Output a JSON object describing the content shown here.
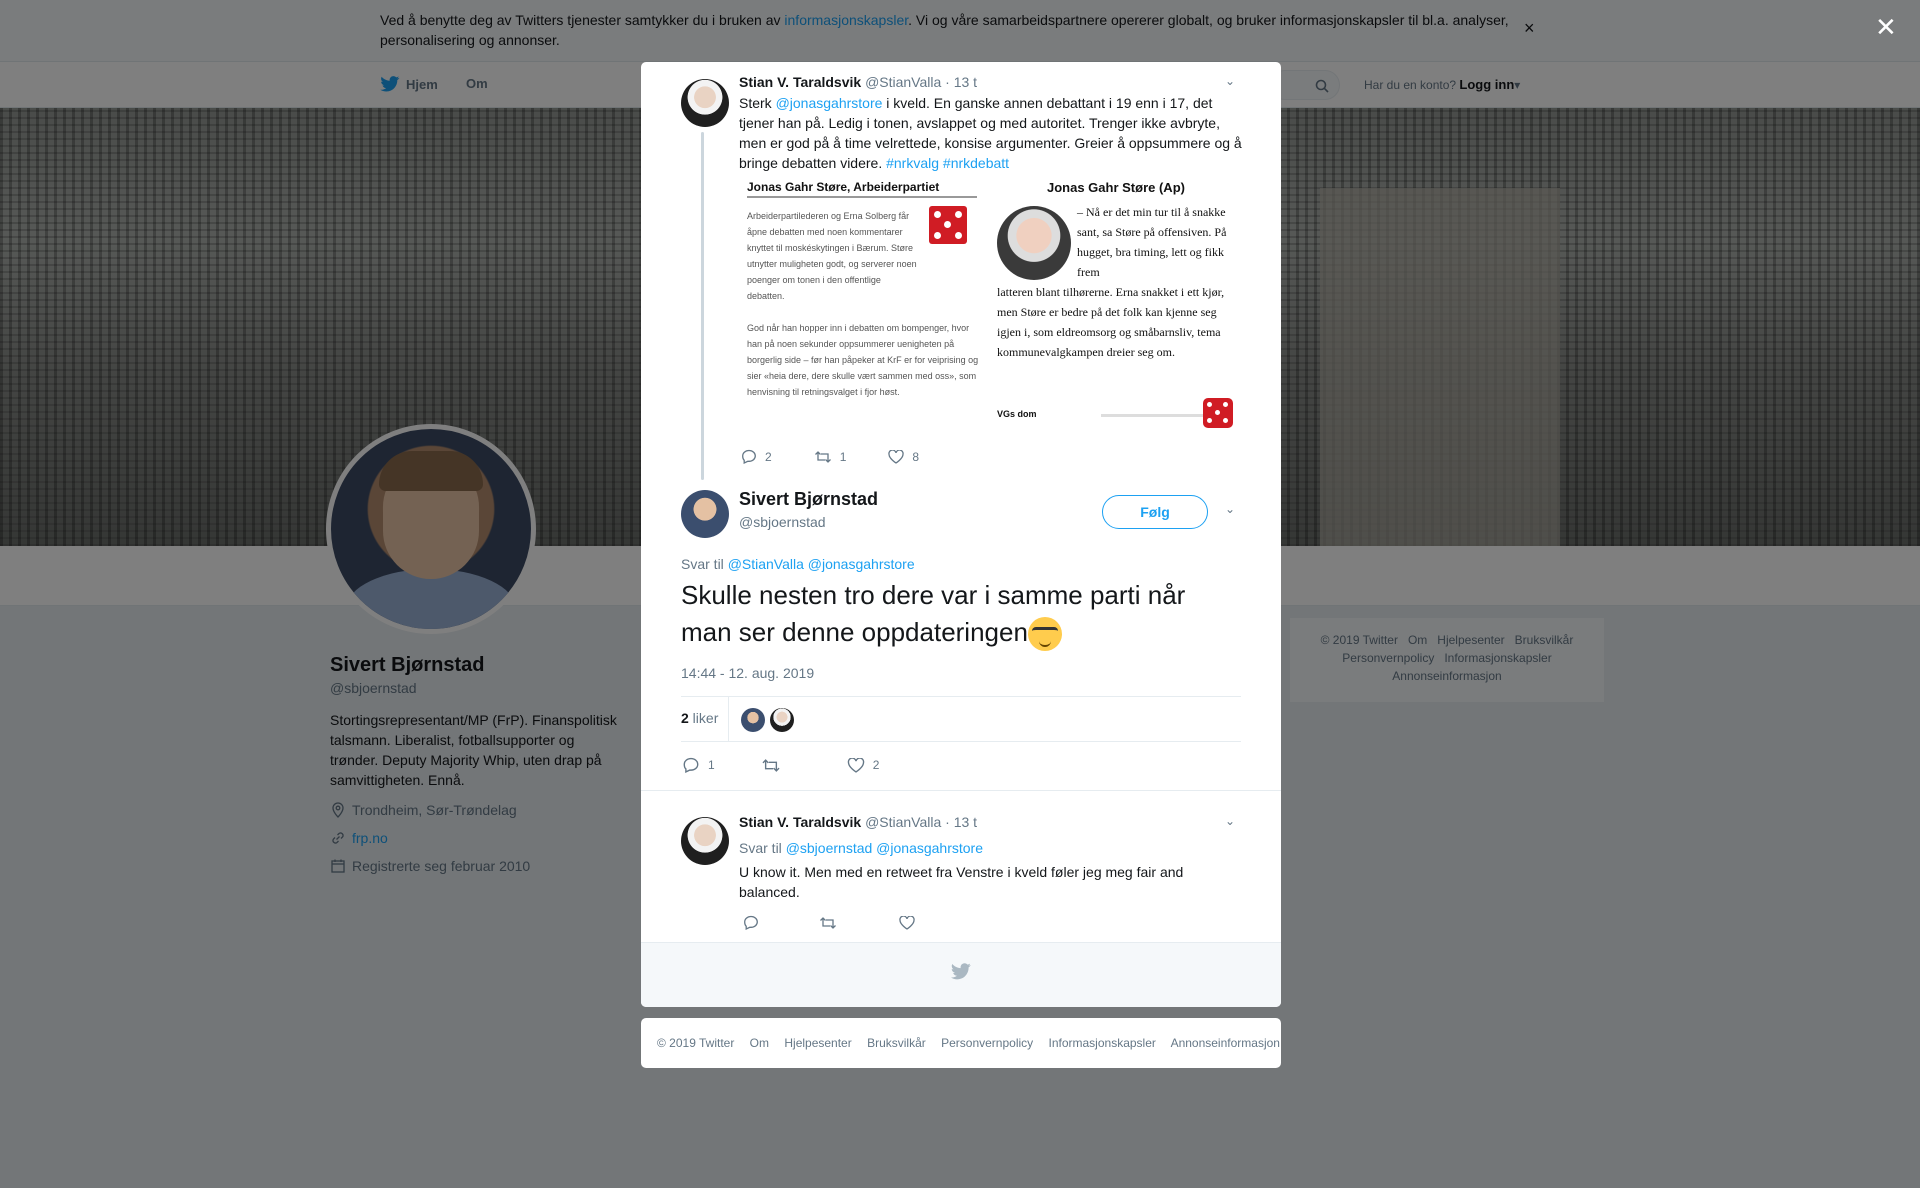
{
  "cookie": {
    "text_before": "Ved å benytte deg av Twitters tjenester samtykker du i bruken av ",
    "link": "informasjonskapsler",
    "text_after": ". Vi og våre samarbeidspartnere opererer globalt, og bruker informasjonskapsler til bl.a. analyser, personalisering og annonser.",
    "close": "×"
  },
  "nav": {
    "home": "Hjem",
    "about": "Om",
    "account_q": "Har du en konto?",
    "login": "Logg inn"
  },
  "profile": {
    "name": "Sivert Bjørnstad",
    "handle": "@sbjoernstad",
    "bio": "Stortingsrepresentant/MP (FrP). Finanspolitisk talsmann. Liberalist, fotballsupporter og trønder. Deputy Majority Whip, uten drap på samvittigheten. Ennå.",
    "location": "Trondheim, Sør-Trøndelag",
    "website": "frp.no",
    "joined": "Registrerte seg februar 2010"
  },
  "side_footer": {
    "row1": [
      "© 2019 Twitter",
      "Om",
      "Hjelpesenter",
      "Bruksvilkår"
    ],
    "row2": [
      "Personvernpolicy",
      "Informasjonskapsler"
    ],
    "row3": [
      "Annonseinformasjon"
    ]
  },
  "close_modal": "✕",
  "tweet1": {
    "name": "Stian V. Taraldsvik",
    "handle": "@StianValla",
    "time": "· 13 t",
    "text_a": "Sterk ",
    "mention": "@jonasgahrstore",
    "text_b": " i kveld. En ganske annen debattant i 19 enn i 17, det tjener han på. Ledig i tonen, avslappet og med autoritet. Trenger ikke avbryte, men er god på å time velrettede, konsise argumenter. Greier å oppsummere og å bringe debatten videre. ",
    "hashtags": "#nrkvalg #nrkdebatt",
    "media": {
      "left_title": "Jonas Gahr Støre, Arbeiderpartiet",
      "left_p1": "Arbeiderpartilederen og Erna Solberg får åpne debatten med noen kommentarer knyttet til moskéskytingen i Bærum. Støre utnytter muligheten godt, og serverer noen poenger om tonen i den offentlige debatten.",
      "left_p2": "God når han hopper inn i debatten om bompenger, hvor han på noen sekunder oppsummerer uenigheten på borgerlig side – før han påpeker at KrF er for veiprising og sier «heia dere, dere skulle vært sammen med oss», som henvisning til retningsvalget i fjor høst.",
      "right_title": "Jonas Gahr Støre (Ap)",
      "right_p1": "– Nå er det min tur til å snakke sant, sa Støre på offensiven. På hugget, bra timing, lett og fikk frem",
      "right_p2": "latteren blant tilhørerne. Erna snakket i ett kjør, men Støre er bedre på det folk kan kjenne seg igjen i, som eldreomsorg og småbarnsliv, tema kommunevalgkampen dreier seg om.",
      "vgs": "VGs dom"
    },
    "replies": "2",
    "retweets": "1",
    "likes": "8"
  },
  "main_tweet": {
    "name": "Sivert Bjørnstad",
    "handle": "@sbjoernstad",
    "follow": "Følg",
    "reply_to_label": "Svar til ",
    "reply_to": "@StianValla @jonasgahrstore",
    "text": "Skulle nesten tro dere var i samme parti når man ser denne oppdateringen",
    "datetime": "14:44 - 12. aug. 2019",
    "likes_count": "2",
    "likes_label": " liker",
    "replies": "1",
    "retweets": "",
    "hearts": "2"
  },
  "tweet3": {
    "name": "Stian V. Taraldsvik",
    "handle": "@StianValla",
    "time": "· 13 t",
    "reply_to_label": "Svar til ",
    "reply_to": "@sbjoernstad @jonasgahrstore",
    "text": "U know it. Men med en retweet fra Venstre i kveld føler jeg meg fair and balanced."
  },
  "bottom_footer": [
    "© 2019 Twitter",
    "Om",
    "Hjelpesenter",
    "Bruksvilkår",
    "Personvernpolicy",
    "Informasjonskapsler",
    "Annonseinformasjon"
  ]
}
